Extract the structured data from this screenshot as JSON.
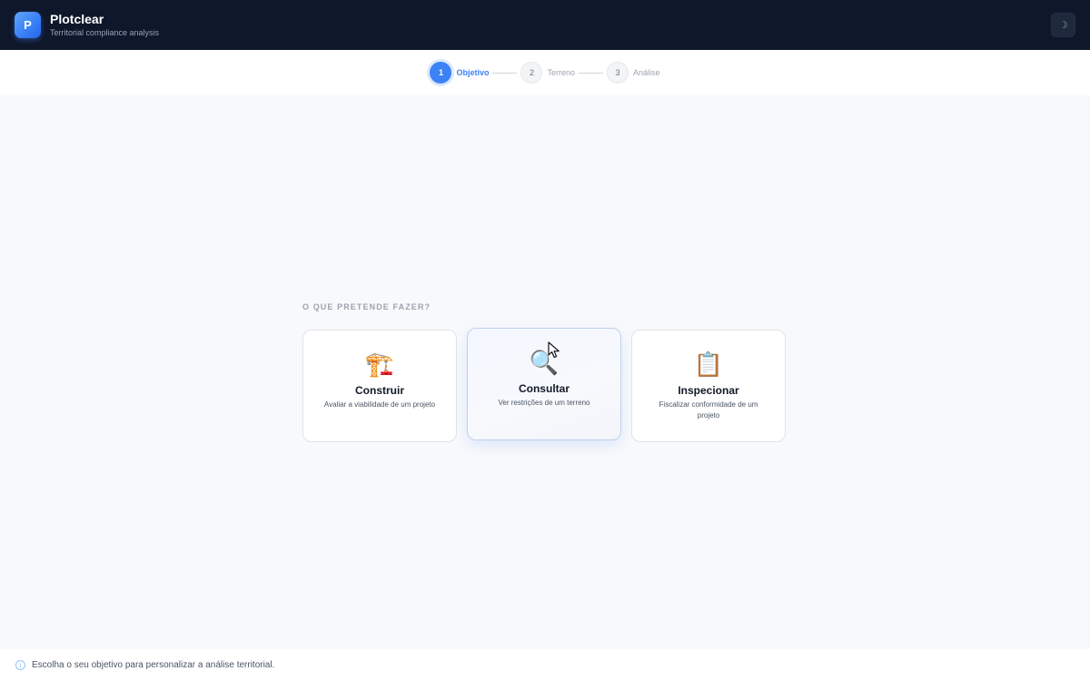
{
  "header": {
    "logo_letter": "P",
    "title": "Plotclear",
    "subtitle": "Territorial compliance analysis",
    "theme_toggle_icon": "moon-icon",
    "theme_toggle_glyph": "☽"
  },
  "stepper": {
    "steps": [
      {
        "number": "1",
        "label": "Objetivo",
        "active": true
      },
      {
        "number": "2",
        "label": "Terreno",
        "active": false
      },
      {
        "number": "3",
        "label": "Análise",
        "active": false
      }
    ]
  },
  "main": {
    "heading": "O QUE PRETENDE FAZER?",
    "options": [
      {
        "icon": "crane-icon",
        "glyph": "🏗️",
        "title": "Construir",
        "description": "Avaliar a viabilidade de um projeto"
      },
      {
        "icon": "magnifier-icon",
        "glyph": "🔍",
        "title": "Consultar",
        "description": "Ver restrições de um terreno"
      },
      {
        "icon": "clipboard-icon",
        "glyph": "📋",
        "title": "Inspecionar",
        "description": "Fiscalizar conformidade de um projeto"
      }
    ]
  },
  "footer": {
    "info_glyph": "i",
    "message": "Escolha o seu objetivo para personalizar a análise territorial."
  },
  "colors": {
    "header_bg": "#0f172a",
    "accent": "#3b82f6",
    "page_bg": "#f8f9fb"
  }
}
